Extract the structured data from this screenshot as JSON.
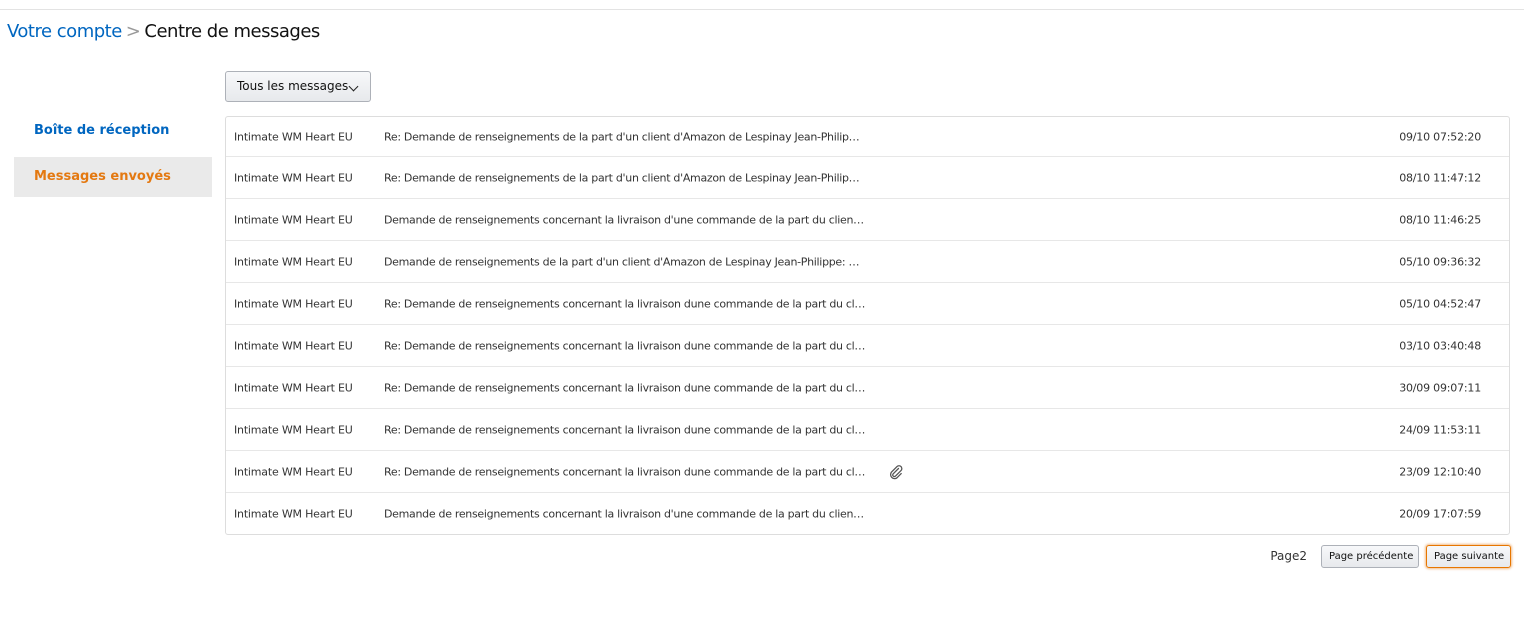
{
  "breadcrumb": {
    "parent": "Votre compte",
    "separator": ">",
    "current": "Centre de messages"
  },
  "filter": {
    "label": "Tous les messages",
    "icon": "chevron-down-icon"
  },
  "sidebar": {
    "items": [
      {
        "label": "Boîte de réception",
        "selected": false
      },
      {
        "label": "Messages envoyés",
        "selected": true
      }
    ]
  },
  "messages": [
    {
      "sender": "Intimate WM Heart EU",
      "subject": "Re: Demande de renseignements de la part d'un client d'Amazon de Lespinay Jean-Philip…",
      "date": "09/10 07:52:20",
      "attachment": false
    },
    {
      "sender": "Intimate WM Heart EU",
      "subject": "Re: Demande de renseignements de la part d'un client d'Amazon de Lespinay Jean-Philip…",
      "date": "08/10 11:47:12",
      "attachment": false
    },
    {
      "sender": "Intimate WM Heart EU",
      "subject": "Demande de renseignements concernant la livraison d'une commande de la part du clien…",
      "date": "08/10 11:46:25",
      "attachment": false
    },
    {
      "sender": "Intimate WM Heart EU",
      "subject": "Demande de renseignements de la part d'un client d'Amazon de Lespinay Jean-Philippe: …",
      "date": "05/10 09:36:32",
      "attachment": false
    },
    {
      "sender": "Intimate WM Heart EU",
      "subject": "Re: Demande de renseignements concernant la livraison dune commande de la part du cl…",
      "date": "05/10 04:52:47",
      "attachment": false
    },
    {
      "sender": "Intimate WM Heart EU",
      "subject": "Re: Demande de renseignements concernant la livraison dune commande de la part du cl…",
      "date": "03/10 03:40:48",
      "attachment": false
    },
    {
      "sender": "Intimate WM Heart EU",
      "subject": "Re: Demande de renseignements concernant la livraison dune commande de la part du cl…",
      "date": "30/09 09:07:11",
      "attachment": false
    },
    {
      "sender": "Intimate WM Heart EU",
      "subject": "Re: Demande de renseignements concernant la livraison dune commande de la part du cl…",
      "date": "24/09 11:53:11",
      "attachment": false
    },
    {
      "sender": "Intimate WM Heart EU",
      "subject": "Re: Demande de renseignements concernant la livraison dune commande de la part du cl…",
      "date": "23/09 12:10:40",
      "attachment": true
    },
    {
      "sender": "Intimate WM Heart EU",
      "subject": "Demande de renseignements concernant la livraison d'une commande de la part du clien…",
      "date": "20/09 17:07:59",
      "attachment": false
    }
  ],
  "pagination": {
    "page_label": "Page2",
    "prev_label": "Page précédente",
    "next_label": "Page suivante"
  },
  "colors": {
    "link": "#0066c0",
    "selected": "#e47911"
  }
}
